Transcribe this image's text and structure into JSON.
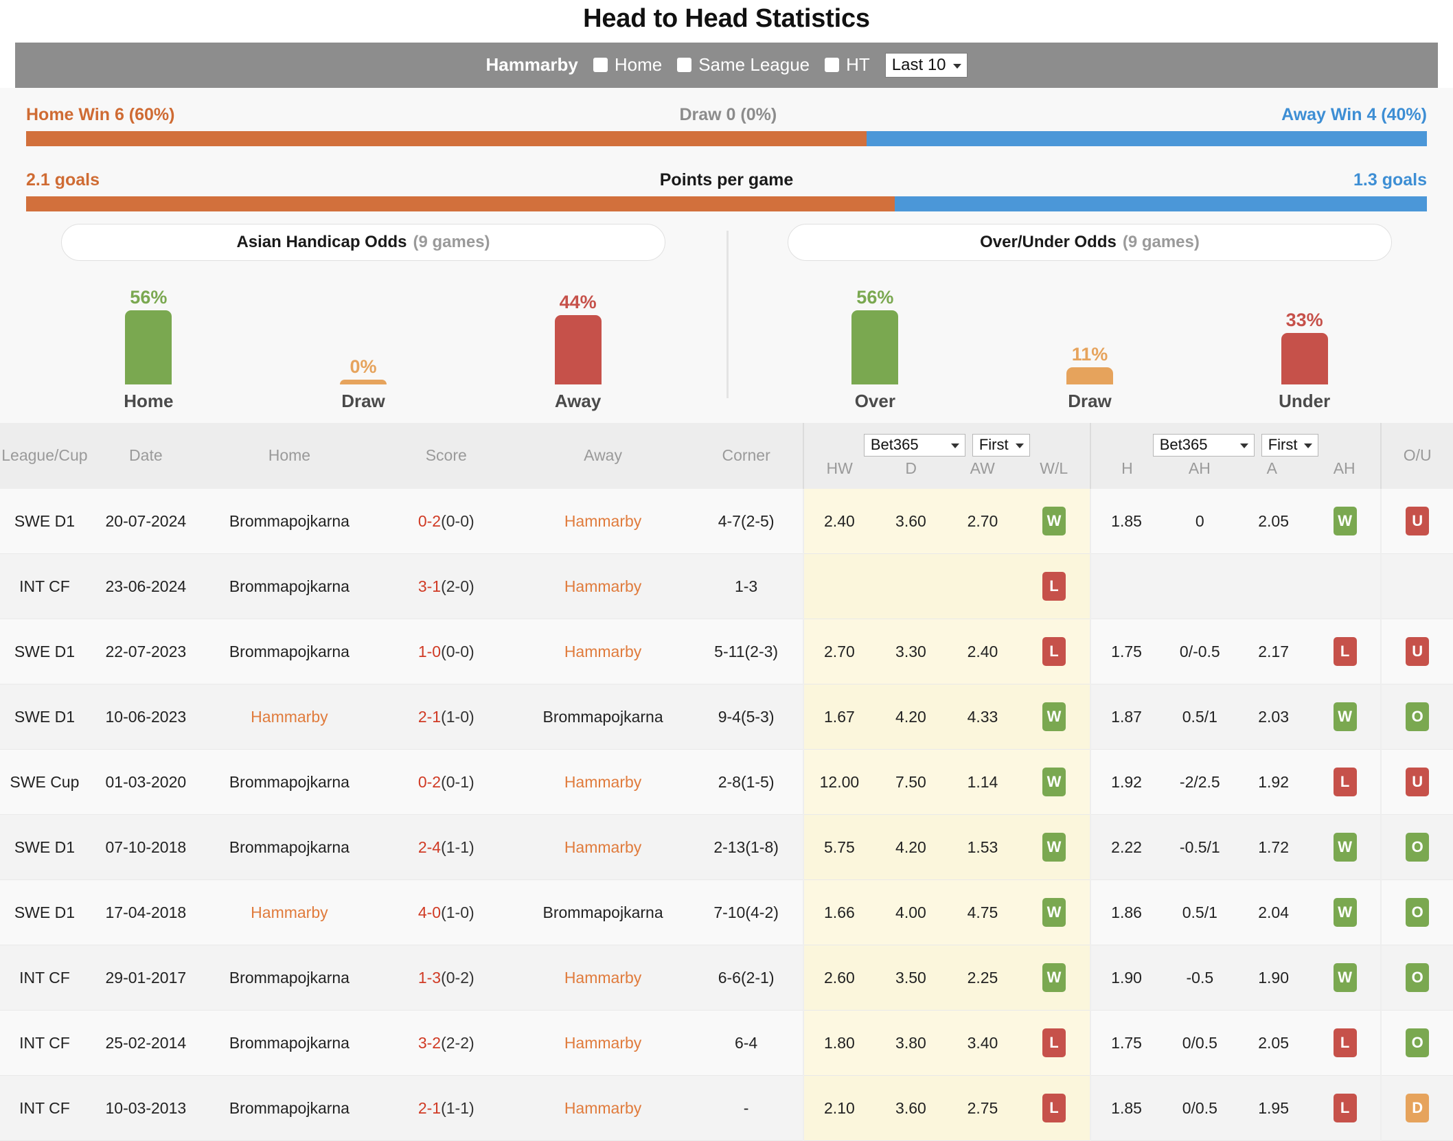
{
  "page_title": "Head to Head Statistics",
  "toolbar": {
    "team": "Hammarby",
    "checkboxes": [
      {
        "label": "Home",
        "checked": false
      },
      {
        "label": "Same League",
        "checked": false
      },
      {
        "label": "HT",
        "checked": false
      }
    ],
    "range_select": {
      "value": "Last 10"
    }
  },
  "summary": {
    "home_win_label": "Home Win 6 (60%)",
    "draw_label": "Draw 0 (0%)",
    "away_win_label": "Away Win 4 (40%)",
    "wins_home_pct": 60,
    "wins_away_pct": 40,
    "ppg_home_label": "2.1 goals",
    "ppg_title": "Points per game",
    "ppg_away_label": "1.3 goals",
    "ppg_home_pct": 62,
    "ppg_away_pct": 38
  },
  "chart_data": [
    {
      "type": "bar",
      "title": "Asian Handicap Odds",
      "subtitle": "(9 games)",
      "categories": [
        "Home",
        "Draw",
        "Away"
      ],
      "values": [
        56,
        0,
        44
      ],
      "value_labels": [
        "56%",
        "0%",
        "44%"
      ],
      "colors": [
        "#7aa850",
        "#e6a35c",
        "#c6514a"
      ],
      "ylabel": "",
      "xlabel": "",
      "ylim": [
        0,
        100
      ],
      "grid": false,
      "legend": "none"
    },
    {
      "type": "bar",
      "title": "Over/Under Odds",
      "subtitle": "(9 games)",
      "categories": [
        "Over",
        "Draw",
        "Under"
      ],
      "values": [
        56,
        11,
        33
      ],
      "value_labels": [
        "56%",
        "11%",
        "33%"
      ],
      "colors": [
        "#7aa850",
        "#e6a35c",
        "#c6514a"
      ],
      "ylabel": "",
      "xlabel": "",
      "ylim": [
        0,
        100
      ],
      "grid": false,
      "legend": "none"
    }
  ],
  "table": {
    "headers": {
      "league": "League/Cup",
      "date": "Date",
      "home": "Home",
      "score": "Score",
      "away": "Away",
      "corner": "Corner",
      "ou": "O/U"
    },
    "odds_group": {
      "bookmaker": "Bet365",
      "timing": "First",
      "cols": [
        "HW",
        "D",
        "AW",
        "W/L"
      ]
    },
    "ah_group": {
      "bookmaker": "Bet365",
      "timing": "First",
      "cols": [
        "H",
        "AH",
        "A",
        "AH"
      ]
    },
    "rows": [
      {
        "league": "SWE D1",
        "date": "20-07-2024",
        "home": "Brommapojkarna",
        "home_hl": false,
        "score": "0-2",
        "ht": "(0-0)",
        "away": "Hammarby",
        "away_hl": true,
        "corner": "4-7(2-5)",
        "hw": "2.40",
        "d": "3.60",
        "aw": "2.70",
        "wl": "W",
        "h": "1.85",
        "ah": "0",
        "a": "2.05",
        "ah2": "W",
        "ou": "U"
      },
      {
        "league": "INT CF",
        "date": "23-06-2024",
        "home": "Brommapojkarna",
        "home_hl": false,
        "score": "3-1",
        "ht": "(2-0)",
        "away": "Hammarby",
        "away_hl": true,
        "corner": "1-3",
        "hw": "",
        "d": "",
        "aw": "",
        "wl": "L",
        "h": "",
        "ah": "",
        "a": "",
        "ah2": "",
        "ou": ""
      },
      {
        "league": "SWE D1",
        "date": "22-07-2023",
        "home": "Brommapojkarna",
        "home_hl": false,
        "score": "1-0",
        "ht": "(0-0)",
        "away": "Hammarby",
        "away_hl": true,
        "corner": "5-11(2-3)",
        "hw": "2.70",
        "d": "3.30",
        "aw": "2.40",
        "wl": "L",
        "h": "1.75",
        "ah": "0/-0.5",
        "a": "2.17",
        "ah2": "L",
        "ou": "U"
      },
      {
        "league": "SWE D1",
        "date": "10-06-2023",
        "home": "Hammarby",
        "home_hl": true,
        "score": "2-1",
        "ht": "(1-0)",
        "away": "Brommapojkarna",
        "away_hl": false,
        "corner": "9-4(5-3)",
        "hw": "1.67",
        "d": "4.20",
        "aw": "4.33",
        "wl": "W",
        "h": "1.87",
        "ah": "0.5/1",
        "a": "2.03",
        "ah2": "W",
        "ou": "O"
      },
      {
        "league": "SWE Cup",
        "date": "01-03-2020",
        "home": "Brommapojkarna",
        "home_hl": false,
        "score": "0-2",
        "ht": "(0-1)",
        "away": "Hammarby",
        "away_hl": true,
        "corner": "2-8(1-5)",
        "hw": "12.00",
        "d": "7.50",
        "aw": "1.14",
        "wl": "W",
        "h": "1.92",
        "ah": "-2/2.5",
        "a": "1.92",
        "ah2": "L",
        "ou": "U"
      },
      {
        "league": "SWE D1",
        "date": "07-10-2018",
        "home": "Brommapojkarna",
        "home_hl": false,
        "score": "2-4",
        "ht": "(1-1)",
        "away": "Hammarby",
        "away_hl": true,
        "corner": "2-13(1-8)",
        "hw": "5.75",
        "d": "4.20",
        "aw": "1.53",
        "wl": "W",
        "h": "2.22",
        "ah": "-0.5/1",
        "a": "1.72",
        "ah2": "W",
        "ou": "O"
      },
      {
        "league": "SWE D1",
        "date": "17-04-2018",
        "home": "Hammarby",
        "home_hl": true,
        "score": "4-0",
        "ht": "(1-0)",
        "away": "Brommapojkarna",
        "away_hl": false,
        "corner": "7-10(4-2)",
        "hw": "1.66",
        "d": "4.00",
        "aw": "4.75",
        "wl": "W",
        "h": "1.86",
        "ah": "0.5/1",
        "a": "2.04",
        "ah2": "W",
        "ou": "O"
      },
      {
        "league": "INT CF",
        "date": "29-01-2017",
        "home": "Brommapojkarna",
        "home_hl": false,
        "score": "1-3",
        "ht": "(0-2)",
        "away": "Hammarby",
        "away_hl": true,
        "corner": "6-6(2-1)",
        "hw": "2.60",
        "d": "3.50",
        "aw": "2.25",
        "wl": "W",
        "h": "1.90",
        "ah": "-0.5",
        "a": "1.90",
        "ah2": "W",
        "ou": "O"
      },
      {
        "league": "INT CF",
        "date": "25-02-2014",
        "home": "Brommapojkarna",
        "home_hl": false,
        "score": "3-2",
        "ht": "(2-2)",
        "away": "Hammarby",
        "away_hl": true,
        "corner": "6-4",
        "hw": "1.80",
        "d": "3.80",
        "aw": "3.40",
        "wl": "L",
        "h": "1.75",
        "ah": "0/0.5",
        "a": "2.05",
        "ah2": "L",
        "ou": "O"
      },
      {
        "league": "INT CF",
        "date": "10-03-2013",
        "home": "Brommapojkarna",
        "home_hl": false,
        "score": "2-1",
        "ht": "(1-1)",
        "away": "Hammarby",
        "away_hl": true,
        "corner": "-",
        "hw": "2.10",
        "d": "3.60",
        "aw": "2.75",
        "wl": "L",
        "h": "1.85",
        "ah": "0/0.5",
        "a": "1.95",
        "ah2": "L",
        "ou": "D"
      }
    ]
  },
  "colors": {
    "home_orange": "#d2703c",
    "away_blue": "#4b97d8",
    "green": "#7aa850",
    "red": "#c6514a",
    "amber": "#e6a35c",
    "highlight_row": "#fdf8e1"
  }
}
